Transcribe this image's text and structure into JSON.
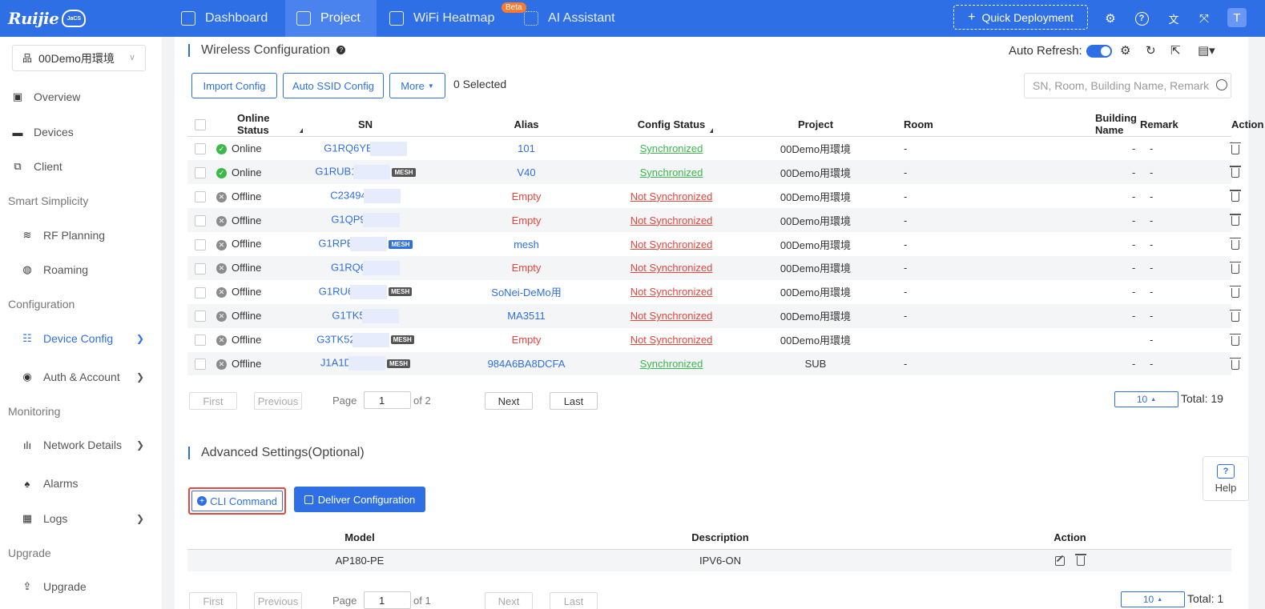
{
  "header": {
    "logo_text": "Ruijie",
    "logo_badge": "JaCS",
    "nav": [
      {
        "label": "Dashboard",
        "icon": "home-icon"
      },
      {
        "label": "Project",
        "icon": "cube-icon"
      },
      {
        "label": "WiFi Heatmap",
        "icon": "heatmap-icon"
      },
      {
        "label": "AI Assistant",
        "icon": "grid-icon"
      }
    ],
    "beta_badge": "Beta",
    "quick_deployment": "Quick Deployment",
    "avatar_letter": "T",
    "brand_color": "#2f6fe6"
  },
  "sidebar": {
    "project_select": "00Demo用環境",
    "items": [
      {
        "label": "Overview"
      },
      {
        "label": "Devices"
      },
      {
        "label": "Client"
      },
      {
        "label": "RF Planning"
      },
      {
        "label": "Roaming"
      },
      {
        "label": "Device Config"
      },
      {
        "label": "Auth & Account"
      },
      {
        "label": "Network Details"
      },
      {
        "label": "Alarms"
      },
      {
        "label": "Logs"
      },
      {
        "label": "Upgrade"
      }
    ],
    "sections": [
      "Smart Simplicity",
      "Configuration",
      "Monitoring",
      "Upgrade"
    ]
  },
  "wireless": {
    "title": "Wireless Configuration",
    "auto_refresh": "Auto Refresh:",
    "import_config": "Import Config",
    "auto_ssid": "Auto SSID Config",
    "more": "More",
    "selected": "0 Selected",
    "search_placeholder": "SN, Room, Building Name, Remark",
    "columns": [
      "Online Status",
      "SN",
      "Alias",
      "Config Status",
      "Project",
      "Room",
      "Building Name",
      "Remark",
      "Action"
    ],
    "rows": [
      {
        "status": "Online",
        "sn": "G1RQ6YB",
        "mesh": "",
        "alias": "101",
        "alias_empty": false,
        "config": "Synchronized",
        "synced": true,
        "project": "00Demo用環境",
        "room": "-",
        "building": "-",
        "remark": "-"
      },
      {
        "status": "Online",
        "sn": "G1RUB1",
        "mesh": "MESH",
        "alias": "V40",
        "alias_empty": false,
        "config": "Synchronized",
        "synced": true,
        "project": "00Demo用環境",
        "room": "-",
        "building": "-",
        "remark": "-"
      },
      {
        "status": "Offline",
        "sn": "C23494",
        "mesh": "",
        "alias": "Empty",
        "alias_empty": true,
        "config": "Not Synchronized",
        "synced": false,
        "project": "00Demo用環境",
        "room": "-",
        "building": "-",
        "remark": "-"
      },
      {
        "status": "Offline",
        "sn": "G1QP9",
        "mesh": "",
        "alias": "Empty",
        "alias_empty": true,
        "config": "Not Synchronized",
        "synced": false,
        "project": "00Demo用環境",
        "room": "-",
        "building": "-",
        "remark": "-"
      },
      {
        "status": "Offline",
        "sn": "G1RPE",
        "mesh": "MESH",
        "alias": "mesh",
        "alias_empty": false,
        "config": "Not Synchronized",
        "synced": false,
        "project": "00Demo用環境",
        "room": "-",
        "building": "-",
        "remark": "-"
      },
      {
        "status": "Offline",
        "sn": "G1RQ6",
        "mesh": "",
        "alias": "Empty",
        "alias_empty": true,
        "config": "Not Synchronized",
        "synced": false,
        "project": "00Demo用環境",
        "room": "-",
        "building": "-",
        "remark": "-"
      },
      {
        "status": "Offline",
        "sn": "G1RU6",
        "mesh": "MESH",
        "alias": "SoNei-DeMo用",
        "alias_empty": false,
        "config": "Not Synchronized",
        "synced": false,
        "project": "00Demo用環境",
        "room": "-",
        "building": "-",
        "remark": "-"
      },
      {
        "status": "Offline",
        "sn": "G1TK5",
        "mesh": "",
        "alias": "MA3511",
        "alias_empty": false,
        "config": "Not Synchronized",
        "synced": false,
        "project": "00Demo用環境",
        "room": "-",
        "building": "-",
        "remark": "-"
      },
      {
        "status": "Offline",
        "sn": "G3TK52",
        "mesh": "MESH",
        "alias": "Empty",
        "alias_empty": true,
        "config": "Not Synchronized",
        "synced": false,
        "project": "00Demo用環境",
        "room": "",
        "building": "",
        "remark": "-"
      },
      {
        "status": "Offline",
        "sn": "J1A1D",
        "mesh": "MESH",
        "alias": "984A6BA8DCFA",
        "alias_empty": false,
        "config": "Synchronized",
        "synced": true,
        "project": "SUB",
        "room": "-",
        "building": "-",
        "remark": "-"
      }
    ],
    "pager": {
      "first": "First",
      "previous": "Previous",
      "page": "Page",
      "current": "1",
      "of": "of 2",
      "next": "Next",
      "last": "Last",
      "size": "10",
      "total": "Total: 19"
    }
  },
  "advanced": {
    "title": "Advanced Settings(Optional)",
    "cli_command": "CLI Command",
    "deliver": "Deliver Configuration",
    "columns": [
      "Model",
      "Description",
      "Action"
    ],
    "rows": [
      {
        "model": "AP180-PE",
        "description": "IPV6-ON"
      }
    ],
    "pager": {
      "first": "First",
      "previous": "Previous",
      "page": "Page",
      "current": "1",
      "of": "of 1",
      "next": "Next",
      "last": "Last",
      "size": "10",
      "total": "Total: 1"
    }
  },
  "help": "Help"
}
